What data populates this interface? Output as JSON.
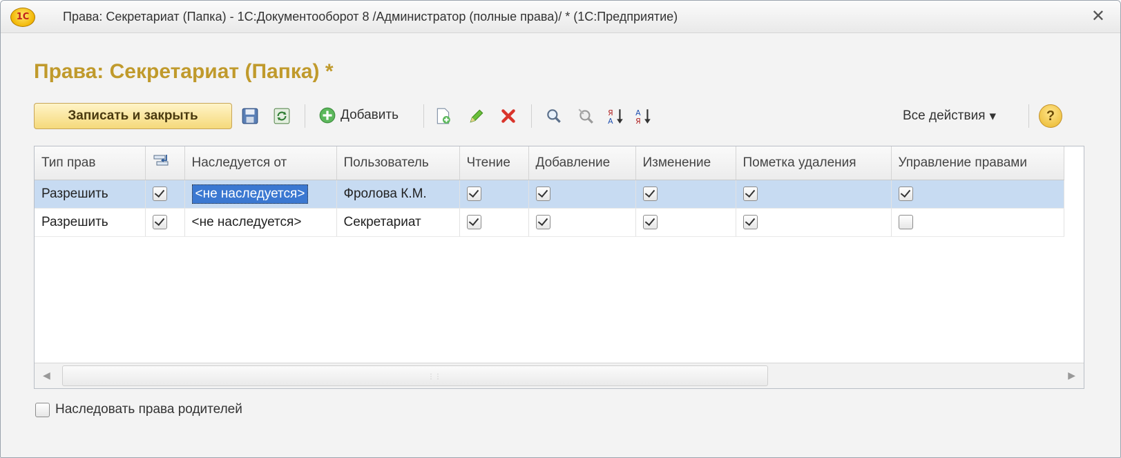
{
  "window": {
    "logo_text": "1С",
    "title": "Права: Секретариат (Папка) - 1С:Документооборот 8 /Администратор (полные права)/ *  (1С:Предприятие)",
    "close_glyph": "✕"
  },
  "form": {
    "title": "Права: Секретариат (Папка) *"
  },
  "toolbar": {
    "save_close_label": "Записать и закрыть",
    "add_label": "Добавить",
    "all_actions_label": "Все действия",
    "all_actions_arrow": "▾",
    "help_label": "?",
    "icons": [
      "save-icon",
      "refresh-icon",
      "add-icon",
      "copy-icon",
      "edit-icon",
      "delete-icon",
      "search-icon",
      "cancel-search-icon",
      "sort-asc-icon",
      "sort-desc-icon"
    ]
  },
  "table": {
    "columns": [
      "Тип прав",
      "",
      "Наследуется от",
      "Пользователь",
      "Чтение",
      "Добавление",
      "Изменение",
      "Пометка удаления",
      "Управление правами"
    ],
    "rows": [
      {
        "type": "Разрешить",
        "flag": true,
        "inherited_from": "<не наследуется>",
        "user": "Фролова К.М.",
        "read": true,
        "add": true,
        "edit": true,
        "mark_delete": true,
        "manage": true,
        "selected": true
      },
      {
        "type": "Разрешить",
        "flag": true,
        "inherited_from": "<не наследуется>",
        "user": "Секретариат",
        "read": true,
        "add": true,
        "edit": true,
        "mark_delete": true,
        "manage": false,
        "selected": false
      }
    ]
  },
  "footer": {
    "inherit_parent_label": "Наследовать права родителей",
    "inherit_parent_checked": false
  },
  "colors": {
    "title_accent": "#c09a2c",
    "selected_row": "#c7dbf2",
    "primary_button": "#f5d97a"
  }
}
